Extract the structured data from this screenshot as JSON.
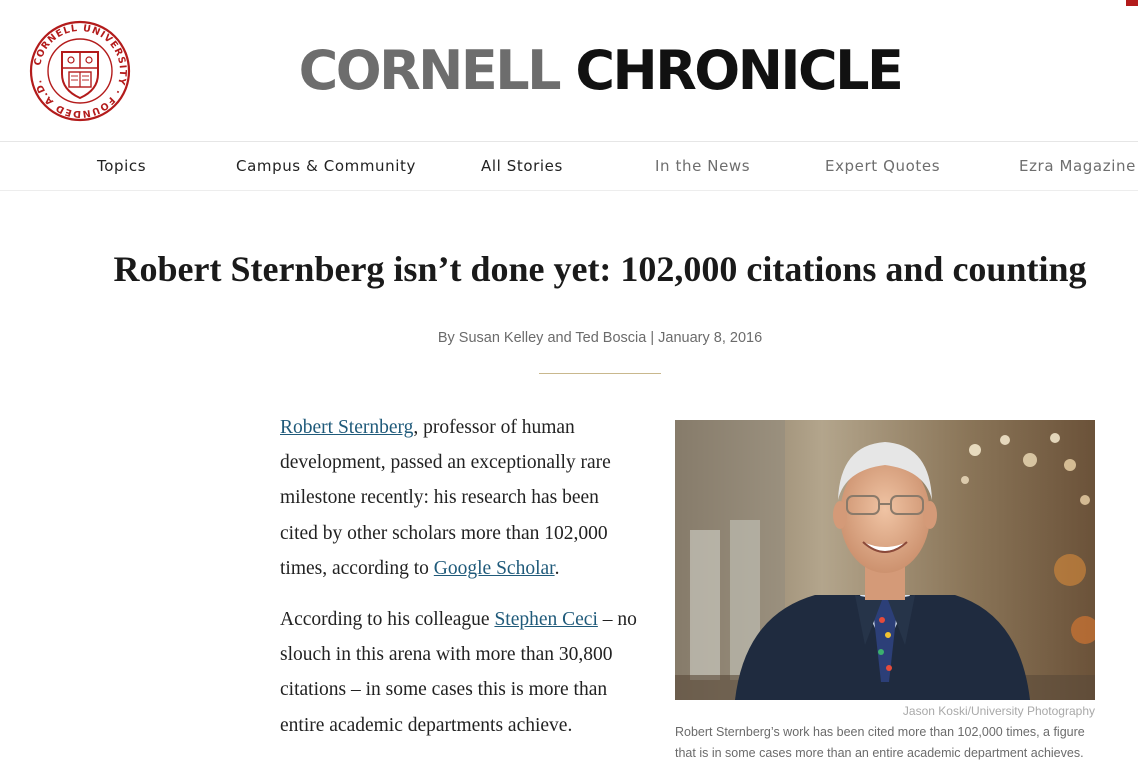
{
  "brand": {
    "seal_text": "CORNELL UNIVERSITY · FOUNDED A.D. 1865",
    "masthead_word1": "CORNELL",
    "masthead_word2": "CHRONICLE",
    "accent_color": "#b31b1b"
  },
  "nav": {
    "items": [
      {
        "label": "Topics"
      },
      {
        "label": "Campus & Community"
      },
      {
        "label": "All Stories"
      },
      {
        "label": "In the News"
      },
      {
        "label": "Expert Quotes"
      },
      {
        "label": "Ezra Magazine"
      }
    ]
  },
  "article": {
    "headline": "Robert Sternberg isn’t done yet: 102,000 citations and counting",
    "byline": "By Susan Kelley and Ted Boscia | January 8, 2016",
    "paragraphs": [
      {
        "link1": "Robert Sternberg",
        "text1": ", professor of human development, passed an exceptionally rare milestone recently: his research has been cited by other scholars more than 102,000 times, according to ",
        "link2": "Google Scholar",
        "text2": "."
      },
      {
        "text0": "According to his colleague ",
        "link1": "Stephen Ceci",
        "text1": " – no slouch in this arena with more than 30,800 citations – in some cases this is more than entire academic departments achieve."
      }
    ],
    "figure": {
      "credit": "Jason Koski/University Photography",
      "caption": "Robert Sternberg’s work has been cited more than 102,000 times, a figure that is in some cases more than an entire academic department achieves."
    }
  }
}
